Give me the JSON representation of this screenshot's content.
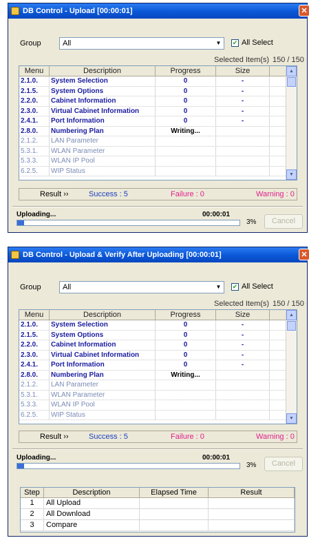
{
  "windows": [
    {
      "title": "DB Control - Upload [00:00:01]",
      "group_label": "Group",
      "group_value": "All",
      "all_select_label": "All Select",
      "all_select_checked": true,
      "selected_label": "Selected Item(s)",
      "selected_count": "150 / 150",
      "columns": [
        "Menu",
        "Description",
        "Progress",
        "Size"
      ],
      "rows": [
        {
          "menu": "2.1.0.",
          "desc": "System Selection",
          "progress": "0",
          "size": "-",
          "state": "active"
        },
        {
          "menu": "2.1.5.",
          "desc": "System Options",
          "progress": "0",
          "size": "-",
          "state": "active"
        },
        {
          "menu": "2.2.0.",
          "desc": "Cabinet Information",
          "progress": "0",
          "size": "-",
          "state": "active"
        },
        {
          "menu": "2.3.0.",
          "desc": "Virtual Cabinet Information",
          "progress": "0",
          "size": "-",
          "state": "active"
        },
        {
          "menu": "2.4.1.",
          "desc": "Port Information",
          "progress": "0",
          "size": "-",
          "state": "active"
        },
        {
          "menu": "2.8.0.",
          "desc": "Numbering Plan",
          "progress": "Writing...",
          "size": "",
          "state": "writing"
        },
        {
          "menu": "2.1.2.",
          "desc": "LAN Parameter",
          "progress": "",
          "size": "",
          "state": "inactive"
        },
        {
          "menu": "5.3.1.",
          "desc": "WLAN Parameter",
          "progress": "",
          "size": "",
          "state": "inactive"
        },
        {
          "menu": "5.3.3.",
          "desc": "WLAN IP Pool",
          "progress": "",
          "size": "",
          "state": "inactive"
        },
        {
          "menu": "6.2.5.",
          "desc": "WIP Status",
          "progress": "",
          "size": "",
          "state": "inactive"
        }
      ],
      "result_label": "Result ››",
      "success": "Success : 5",
      "failure": "Failure : 0",
      "warning": "Warning : 0",
      "status": "Uploading...",
      "time": "00:00:01",
      "percent": "3%",
      "progress_fraction": 0.03,
      "cancel_label": "Cancel"
    },
    {
      "title": "DB Control - Upload & Verify After Uploading [00:00:01]",
      "group_label": "Group",
      "group_value": "All",
      "all_select_label": "All Select",
      "all_select_checked": true,
      "selected_label": "Selected Item(s)",
      "selected_count": "150 / 150",
      "columns": [
        "Menu",
        "Description",
        "Progress",
        "Size"
      ],
      "rows": [
        {
          "menu": "2.1.0.",
          "desc": "System Selection",
          "progress": "0",
          "size": "-",
          "state": "active"
        },
        {
          "menu": "2.1.5.",
          "desc": "System Options",
          "progress": "0",
          "size": "-",
          "state": "active"
        },
        {
          "menu": "2.2.0.",
          "desc": "Cabinet Information",
          "progress": "0",
          "size": "-",
          "state": "active"
        },
        {
          "menu": "2.3.0.",
          "desc": "Virtual Cabinet Information",
          "progress": "0",
          "size": "-",
          "state": "active"
        },
        {
          "menu": "2.4.1.",
          "desc": "Port Information",
          "progress": "0",
          "size": "-",
          "state": "active"
        },
        {
          "menu": "2.8.0.",
          "desc": "Numbering Plan",
          "progress": "Writing...",
          "size": "",
          "state": "writing"
        },
        {
          "menu": "2.1.2.",
          "desc": "LAN Parameter",
          "progress": "",
          "size": "",
          "state": "inactive"
        },
        {
          "menu": "5.3.1.",
          "desc": "WLAN Parameter",
          "progress": "",
          "size": "",
          "state": "inactive"
        },
        {
          "menu": "5.3.3.",
          "desc": "WLAN IP Pool",
          "progress": "",
          "size": "",
          "state": "inactive"
        },
        {
          "menu": "6.2.5.",
          "desc": "WIP Status",
          "progress": "",
          "size": "",
          "state": "inactive"
        }
      ],
      "result_label": "Result ››",
      "success": "Success : 5",
      "failure": "Failure : 0",
      "warning": "Warning : 0",
      "status": "Uploading...",
      "time": "00:00:01",
      "percent": "3%",
      "progress_fraction": 0.03,
      "cancel_label": "Cancel",
      "steps": {
        "columns": [
          "Step",
          "Description",
          "Elapsed Time",
          "Result"
        ],
        "rows": [
          {
            "step": "1",
            "desc": "All Upload",
            "elapsed": "",
            "result": ""
          },
          {
            "step": "2",
            "desc": "All Download",
            "elapsed": "",
            "result": ""
          },
          {
            "step": "3",
            "desc": "Compare",
            "elapsed": "",
            "result": ""
          }
        ]
      }
    }
  ],
  "colors": {
    "success": "#1b3fbf",
    "failure": "#e0208a",
    "warning": "#e0208a"
  }
}
